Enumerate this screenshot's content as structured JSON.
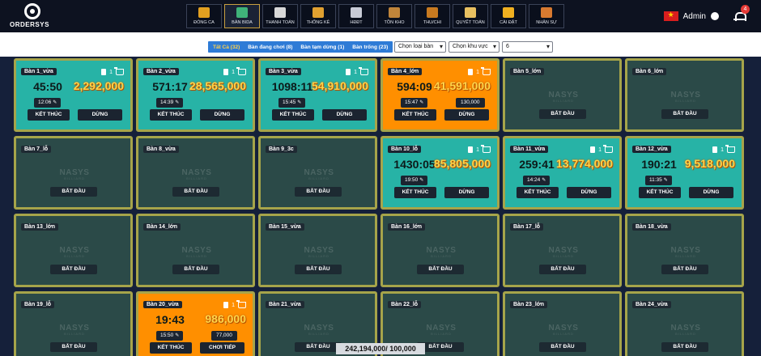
{
  "brand": "ORDERSYS",
  "nav": [
    {
      "label": "ĐÓNG CA",
      "icon": "lock-icon",
      "color": "#e2a020"
    },
    {
      "label": "BÀN BIDA",
      "icon": "billiard-table-icon",
      "color": "#3fb37a",
      "active": true
    },
    {
      "label": "THANH TOÁN",
      "icon": "payment-icon",
      "color": "#d8d8d8"
    },
    {
      "label": "THỐNG KÊ",
      "icon": "chart-icon",
      "color": "#e0a030"
    },
    {
      "label": "HĐĐT",
      "icon": "invoice-cloud-icon",
      "color": "#c8cbd6"
    },
    {
      "label": "TỒN KHO",
      "icon": "warehouse-icon",
      "color": "#c0853a"
    },
    {
      "label": "THU/CHI",
      "icon": "coin-icon",
      "color": "#c87a20"
    },
    {
      "label": "QUYẾT TOÁN",
      "icon": "settlement-icon",
      "color": "#e8c060"
    },
    {
      "label": "CÀI ĐẶT",
      "icon": "gear-icon",
      "color": "#f0b020"
    },
    {
      "label": "NHÂN SỰ",
      "icon": "staff-icon",
      "color": "#d87a30"
    }
  ],
  "header": {
    "user": "Admin",
    "notifications": "4"
  },
  "filters": {
    "tabs": [
      "Tất Cả (32)",
      "Bàn đang chơi (8)",
      "Bàn tạm dừng (1)",
      "Bàn trống (23)"
    ],
    "table_type": "Chọn loại bàn",
    "area": "Chọn khu vực",
    "columns": "6"
  },
  "labels": {
    "end": "KẾT THÚC",
    "stop": "DỪNG",
    "start": "BẮT ĐẦU",
    "continue": "CHƠI TIẾP",
    "wm_big": "NASYS",
    "wm_small": "BILLIARD"
  },
  "tables": [
    {
      "name": "Bàn 1_vừa",
      "status": "playing",
      "count": "1",
      "time": "45:50",
      "amount": "2,292,000",
      "start": "12:06"
    },
    {
      "name": "Bàn 2_vừa",
      "status": "playing",
      "count": "1",
      "time": "571:17",
      "amount": "28,565,000",
      "start": "14:39"
    },
    {
      "name": "Bàn 3_vừa",
      "status": "playing",
      "count": "1",
      "time": "1098:11",
      "amount": "54,910,000",
      "start": "15:45"
    },
    {
      "name": "Bàn 4_lớn",
      "status": "playing-orange",
      "count": "1",
      "time": "594:09",
      "amount": "41,591,000",
      "start": "15:47",
      "sub": "130,000"
    },
    {
      "name": "Bàn 5_lớn",
      "status": "empty"
    },
    {
      "name": "Bàn 6_lớn",
      "status": "empty"
    },
    {
      "name": "Bàn 7_lỗ",
      "status": "empty"
    },
    {
      "name": "Bàn 8_vừa",
      "status": "empty"
    },
    {
      "name": "Bàn 9_3c",
      "status": "empty"
    },
    {
      "name": "Bàn 10_lỗ",
      "status": "playing",
      "count": "1",
      "time": "1430:05",
      "amount": "85,805,000",
      "start": "19:50"
    },
    {
      "name": "Bàn 11_vừa",
      "status": "playing",
      "count": "1",
      "time": "259:41",
      "amount": "13,774,000",
      "start": "14:24"
    },
    {
      "name": "Bàn 12_vừa",
      "status": "playing",
      "count": "1",
      "time": "190:21",
      "amount": "9,518,000",
      "start": "11:35"
    },
    {
      "name": "Bàn 13_lớn",
      "status": "empty"
    },
    {
      "name": "Bàn 14_lớn",
      "status": "empty"
    },
    {
      "name": "Bàn 15_vừa",
      "status": "empty"
    },
    {
      "name": "Bàn 16_lớn",
      "status": "empty"
    },
    {
      "name": "Bàn 17_lỗ",
      "status": "empty"
    },
    {
      "name": "Bàn 18_vừa",
      "status": "empty"
    },
    {
      "name": "Bàn 19_lỗ",
      "status": "empty"
    },
    {
      "name": "Bàn 20_vừa",
      "status": "paused",
      "count": "1",
      "time": "19:43",
      "amount": "986,000",
      "start": "15:50",
      "sub": "77,000"
    },
    {
      "name": "Bàn 21_vừa",
      "status": "empty"
    },
    {
      "name": "Bàn 22_lỗ",
      "status": "empty"
    },
    {
      "name": "Bàn 23_lớn",
      "status": "empty"
    },
    {
      "name": "Bàn 24_vừa",
      "status": "empty"
    }
  ],
  "footer": {
    "total": "242,194,000/ 100,000"
  }
}
